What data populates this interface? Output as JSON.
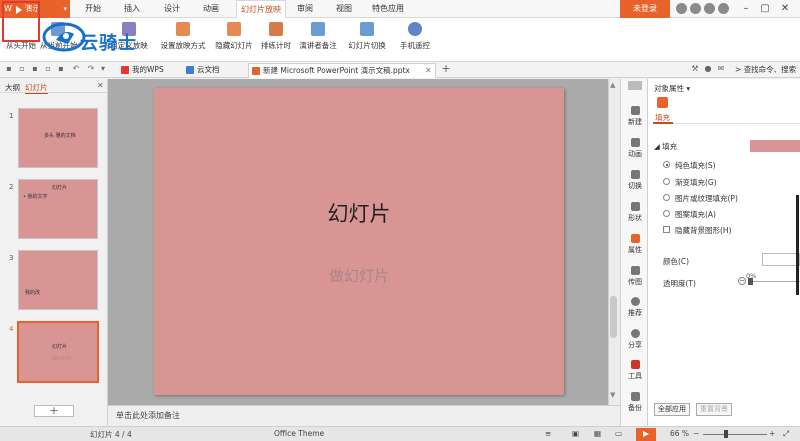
{
  "app": {
    "name": "WPS 演示"
  },
  "menu": {
    "items": [
      "开始",
      "插入",
      "设计",
      "动画",
      "幻灯片放映",
      "审阅",
      "视图",
      "特色应用"
    ],
    "active_index": 4,
    "login_label": "未登录"
  },
  "ribbon": {
    "buttons": [
      "从头开始",
      "从当前开始",
      "自定义放映",
      "设置放映方式",
      "隐藏幻灯片",
      "排练计时",
      "演讲者备注",
      "幻灯片切换",
      "手机遥控"
    ]
  },
  "watermark": {
    "text": "云骑士"
  },
  "tabs": {
    "items": [
      "我的WPS",
      "云文档",
      "新建 Microsoft PowerPoint 演示文稿.pptx"
    ],
    "search_placeholder": "查找命令、搜索"
  },
  "left_panel": {
    "tab_outline": "大纲",
    "tab_slides": "幻灯片",
    "slides": [
      {
        "num": "1",
        "title": "多头 雅的文档"
      },
      {
        "num": "2",
        "title": "幻灯片",
        "bullet": "• 我的文字"
      },
      {
        "num": "3",
        "title": "我的改"
      },
      {
        "num": "4",
        "title": "幻灯片",
        "sub": "做幻灯片"
      }
    ],
    "add_label": "+"
  },
  "slide": {
    "title": "幻灯片",
    "subtitle": "做幻灯片"
  },
  "notes": {
    "placeholder": "单击此处添加备注"
  },
  "side_tools": [
    "新建",
    "动画",
    "切换",
    "形状",
    "属性",
    "传图",
    "推荐",
    "分享",
    "工具",
    "备份"
  ],
  "properties": {
    "title": "对象属性",
    "tab_fill": "填充",
    "section_fill": "填充",
    "fill_options": [
      "纯色填充(S)",
      "渐变填充(G)",
      "图片或纹理填充(P)",
      "图案填充(A)"
    ],
    "selected_fill": 0,
    "hide_bg": "隐藏背景图形(H)",
    "color_label": "颜色(C)",
    "transparency_label": "透明度(T)",
    "transparency_value": "0%",
    "apply_all": "全部应用",
    "reset_bg": "重置背景",
    "swatch_color": "#d99494"
  },
  "status": {
    "slide_counter": "幻灯片 4 / 4",
    "theme": "Office Theme",
    "zoom": "66 %"
  },
  "colors": {
    "accent": "#e8632b",
    "slide_bg": "#d99494"
  }
}
